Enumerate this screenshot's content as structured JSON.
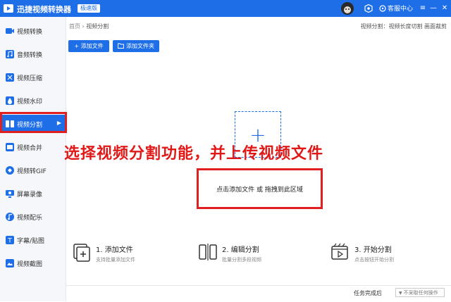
{
  "app": {
    "title": "迅捷视频转换器",
    "badge": "极速版",
    "support": "客服中心"
  },
  "sidebar": {
    "items": [
      {
        "label": "视频转换"
      },
      {
        "label": "音频转换"
      },
      {
        "label": "视频压缩"
      },
      {
        "label": "视频水印"
      },
      {
        "label": "视频分割"
      },
      {
        "label": "视频合并"
      },
      {
        "label": "视频转GIF"
      },
      {
        "label": "屏幕录像"
      },
      {
        "label": "视频配乐"
      },
      {
        "label": "字幕/贴图"
      },
      {
        "label": "视频截图"
      }
    ],
    "active_index": 4
  },
  "breadcrumb": {
    "home": "首页",
    "sep": "›",
    "current": "视频分割"
  },
  "hint": "视频分割：视频长度切割 画面裁剪",
  "toolbar": {
    "add_file": "+ 添加文件",
    "add_folder": "添加文件夹"
  },
  "drop": {
    "plus": "+",
    "text": "点击添加文件 或 拖拽到此区域"
  },
  "annotation": "选择视频分割功能，并上传视频文件",
  "steps": [
    {
      "title": "1. 添加文件",
      "desc": "支持批量添加文件"
    },
    {
      "title": "2. 编辑分割",
      "desc": "批量分割多段视频"
    },
    {
      "title": "3. 开始分割",
      "desc": "点击按钮开始分割"
    }
  ],
  "footer": {
    "label": "任务完成后",
    "select_value": "不采取任何操作"
  },
  "colors": {
    "primary": "#1e6ee8",
    "annotation": "#e01818"
  }
}
